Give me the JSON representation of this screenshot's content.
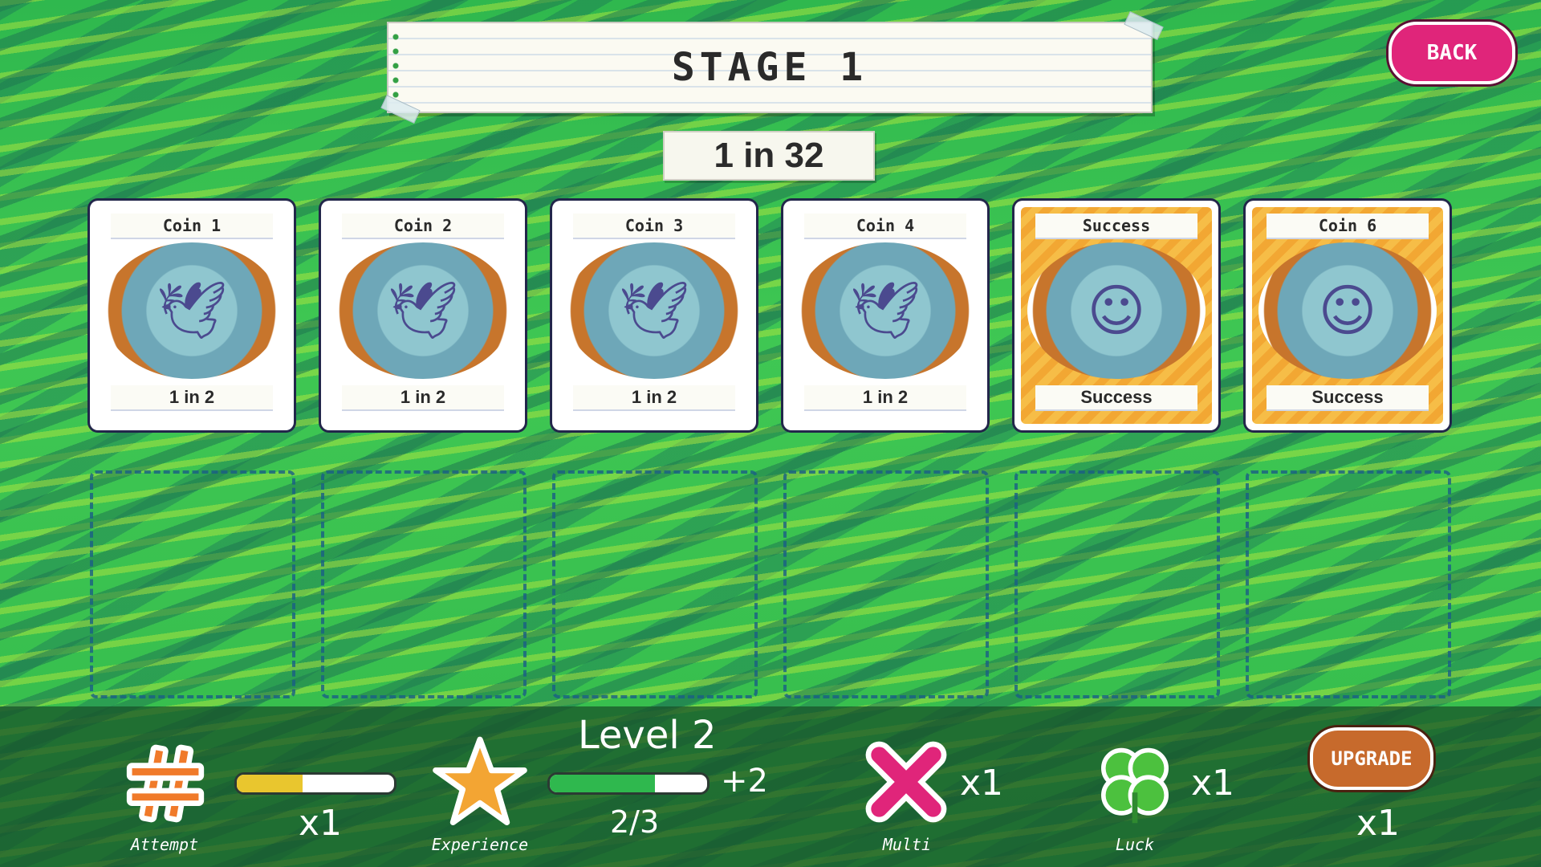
{
  "header": {
    "stage_title": "STAGE 1",
    "odds": "1 in 32",
    "back_label": "BACK"
  },
  "cards": [
    {
      "title": "Coin 1",
      "result": "1 in 2",
      "style": "blue",
      "icon": "bird-coin-icon"
    },
    {
      "title": "Coin 2",
      "result": "1 in 2",
      "style": "blue",
      "icon": "bird-coin-icon"
    },
    {
      "title": "Coin 3",
      "result": "1 in 2",
      "style": "blue",
      "icon": "bird-coin-icon"
    },
    {
      "title": "Coin 4",
      "result": "1 in 2",
      "style": "blue",
      "icon": "bird-coin-icon"
    },
    {
      "title": "Success",
      "result": "Success",
      "style": "gold",
      "icon": "head-coin-icon"
    },
    {
      "title": "Coin 6",
      "result": "Success",
      "style": "gold",
      "icon": "head-coin-icon"
    }
  ],
  "stats": {
    "attempt": {
      "label": "Attempt",
      "multiplier": "x1",
      "progress": 0.42,
      "bar_color": "#e9c62e",
      "icon": "hashtag-icon"
    },
    "experience": {
      "label": "Experience",
      "level": "Level 2",
      "progress_text": "2/3",
      "progress": 0.67,
      "bonus": "+2",
      "bar_color": "#2fb84e",
      "icon": "star-icon"
    },
    "multi": {
      "label": "Multi",
      "multiplier": "x1",
      "icon": "x-cross-icon"
    },
    "luck": {
      "label": "Luck",
      "multiplier": "x1",
      "icon": "clover-icon"
    },
    "upgrade": {
      "label": "UPGRADE",
      "multiplier": "x1"
    }
  },
  "colors": {
    "accent_pink": "#e0257a",
    "upgrade_orange": "#c76a2c",
    "card_blue": "#3b58b8",
    "card_gold": "#f2a733"
  }
}
